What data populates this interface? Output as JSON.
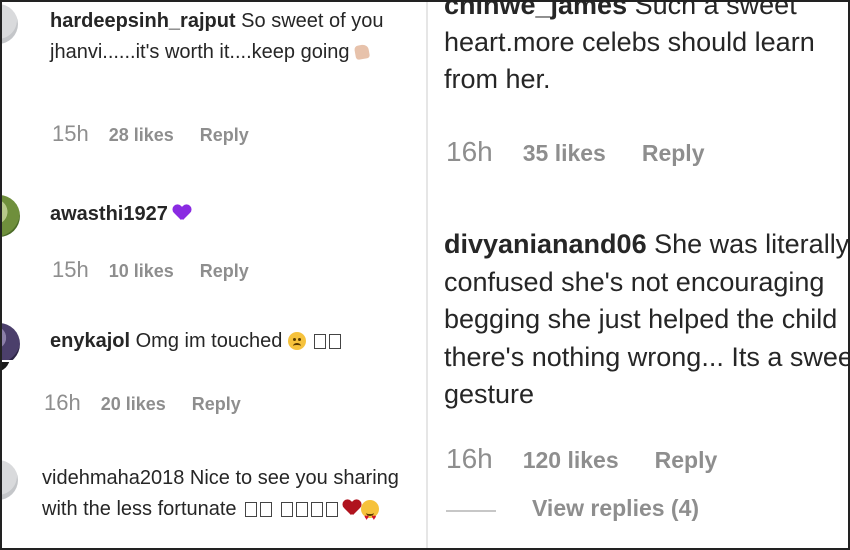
{
  "left_top": {
    "comments": [
      {
        "username": "hardeepsinh_rajput",
        "text": "So sweet of you jhanvi......it's worth it....keep going",
        "emoji": "thumb-emoji",
        "time": "15h",
        "likes": "28 likes",
        "reply": "Reply"
      },
      {
        "username": "awasthi1927",
        "text": "",
        "emoji": "purple-heart-emoji",
        "time": "15h",
        "likes": "10 likes",
        "reply": "Reply"
      },
      {
        "username": "enykajol",
        "text": "Omg im touched",
        "emoji": "sad-face-emoji"
      }
    ]
  },
  "left_bottom": {
    "first_meta": {
      "time": "16h",
      "likes": "20 likes",
      "reply": "Reply"
    },
    "comment": {
      "username": "videhmaha2018",
      "text": "Nice to see you sharing with the less fortunate",
      "emoji": [
        "red-heart-emoji",
        "heart-eyes-emoji"
      ]
    }
  },
  "right": {
    "comments": [
      {
        "username": "chinwe_james",
        "text": "Such a sweet heart.more celebs should learn from her.",
        "time": "16h",
        "likes": "35 likes",
        "reply": "Reply"
      },
      {
        "username": "divyanianand06",
        "text": "She was literally confused she's not encouraging begging she just helped the child there's nothing wrong... Its a sweet gesture",
        "time": "16h",
        "likes": "120 likes",
        "reply": "Reply",
        "view_replies": "View replies (4)"
      }
    ]
  },
  "colors": {
    "text": "#262626",
    "meta": "#8e8e8e",
    "purple_heart": "#8a2be2",
    "red_heart": "#b0131e"
  }
}
